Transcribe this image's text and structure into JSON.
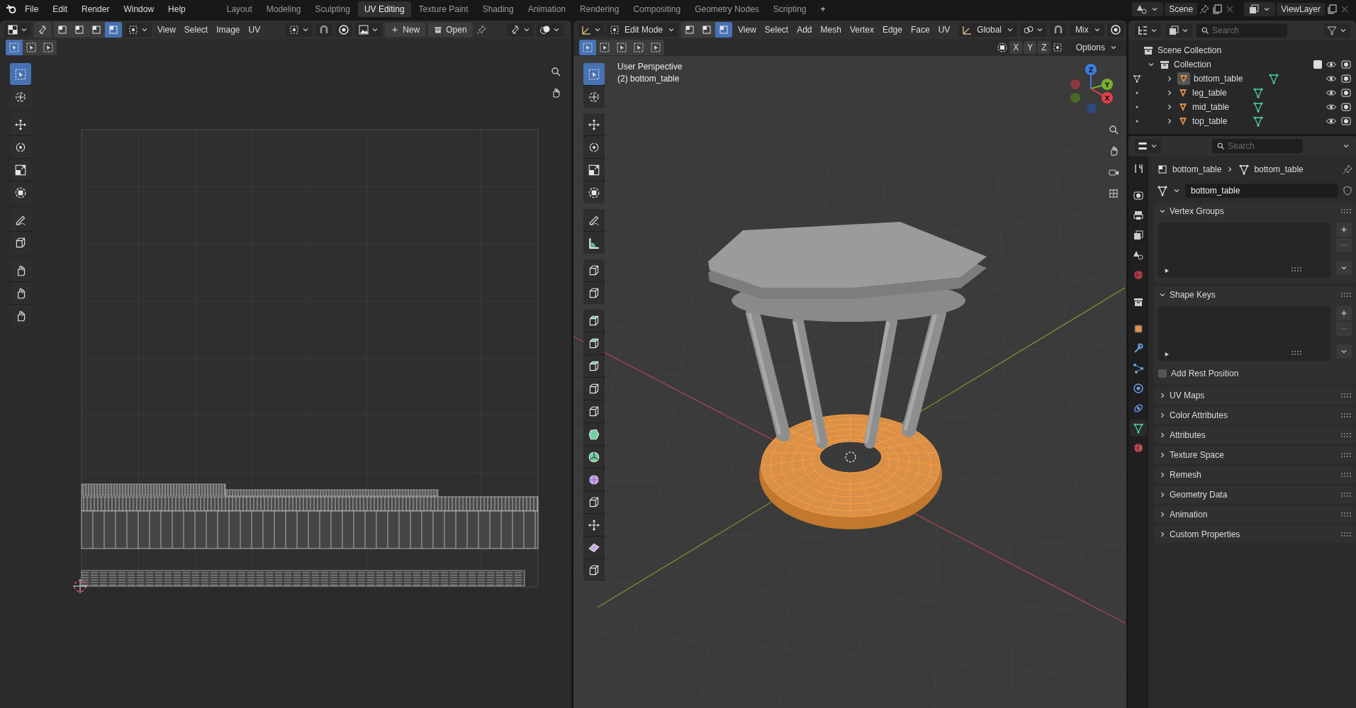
{
  "top_bar": {
    "menus": [
      "File",
      "Edit",
      "Render",
      "Window",
      "Help"
    ],
    "workspaces": [
      {
        "label": "Layout",
        "selected": false
      },
      {
        "label": "Modeling",
        "selected": false
      },
      {
        "label": "Sculpting",
        "selected": false
      },
      {
        "label": "UV Editing",
        "selected": true
      },
      {
        "label": "Texture Paint",
        "selected": false
      },
      {
        "label": "Shading",
        "selected": false
      },
      {
        "label": "Animation",
        "selected": false
      },
      {
        "label": "Rendering",
        "selected": false
      },
      {
        "label": "Compositing",
        "selected": false
      },
      {
        "label": "Geometry Nodes",
        "selected": false
      },
      {
        "label": "Scripting",
        "selected": false
      }
    ],
    "add_workspace": "+",
    "scene": "Scene",
    "view_layer": "ViewLayer"
  },
  "uv_editor": {
    "select_modes": [
      {
        "selected": false
      },
      {
        "selected": false
      },
      {
        "selected": false
      },
      {
        "selected": true
      }
    ],
    "menus": [
      "View",
      "Select",
      "Image",
      "UV"
    ],
    "new_button": "New",
    "open_button": "Open",
    "box_modes": [
      {
        "selected": true
      },
      {
        "selected": false
      },
      {
        "selected": false
      }
    ],
    "tool_groups": [
      [
        {
          "kind": "select",
          "selected": true
        },
        {
          "kind": "cursor",
          "selected": false
        }
      ],
      [
        {
          "kind": "move",
          "selected": false
        },
        {
          "kind": "rotate",
          "selected": false
        },
        {
          "kind": "scale",
          "selected": false
        },
        {
          "kind": "transform",
          "selected": false
        }
      ],
      [
        {
          "kind": "annotate",
          "selected": false
        },
        {
          "kind": "rip",
          "selected": false
        }
      ],
      [
        {
          "kind": "grab",
          "selected": false
        },
        {
          "kind": "pinch",
          "selected": false
        },
        {
          "kind": "relax",
          "selected": false
        }
      ]
    ]
  },
  "viewport": {
    "mode": "Edit Mode",
    "select_modes": [
      {
        "selected": false
      },
      {
        "selected": false
      },
      {
        "selected": true
      }
    ],
    "menus": [
      "View",
      "Select",
      "Add",
      "Mesh",
      "Vertex",
      "Edge",
      "Face",
      "UV"
    ],
    "orientation": "Global",
    "snap_target": "Mix",
    "box_modes": [
      {
        "selected": true
      },
      {
        "selected": false
      },
      {
        "selected": false
      },
      {
        "selected": false
      },
      {
        "selected": false
      }
    ],
    "mirror_axes": [
      "X",
      "Y",
      "Z"
    ],
    "options": "Options",
    "overlay_lines": [
      "User Perspective",
      "(2) bottom_table"
    ],
    "gizmo_axes": [
      "Z",
      "Y",
      "X"
    ],
    "tool_groups": [
      [
        {
          "kind": "select",
          "selected": true
        },
        {
          "kind": "cursor",
          "selected": false
        }
      ],
      [
        {
          "kind": "move",
          "selected": false
        },
        {
          "kind": "rotate",
          "selected": false
        },
        {
          "kind": "scale",
          "selected": false
        },
        {
          "kind": "transform",
          "selected": false
        }
      ],
      [
        {
          "kind": "annotate",
          "selected": false
        },
        {
          "kind": "measure",
          "selected": false
        }
      ],
      [
        {
          "kind": "addcube",
          "selected": false
        },
        {
          "kind": "knife",
          "selected": false
        }
      ],
      [
        {
          "kind": "extrude",
          "selected": false
        },
        {
          "kind": "inset",
          "selected": false
        },
        {
          "kind": "bevel",
          "selected": false
        },
        {
          "kind": "loopcut",
          "selected": false
        },
        {
          "kind": "slide",
          "selected": false
        },
        {
          "kind": "polybuild",
          "selected": false
        },
        {
          "kind": "spin",
          "selected": false
        },
        {
          "kind": "smooth",
          "selected": false
        },
        {
          "kind": "rip",
          "selected": false
        },
        {
          "kind": "shrink",
          "selected": false
        },
        {
          "kind": "shear",
          "selected": false
        },
        {
          "kind": "rip",
          "selected": false
        }
      ]
    ]
  },
  "outliner": {
    "search_placeholder": "Search",
    "scene_collection": "Scene Collection",
    "collection": {
      "name": "Collection",
      "expanded": true,
      "checked": true,
      "children": [
        {
          "name": "bottom_table",
          "selected": true
        },
        {
          "name": "leg_table",
          "selected": false
        },
        {
          "name": "mid_table",
          "selected": false
        },
        {
          "name": "top_table",
          "selected": false
        }
      ]
    }
  },
  "properties": {
    "search_placeholder": "Search",
    "tabs": [
      {
        "kind": "tool",
        "selected": false
      },
      {
        "kind": "render",
        "selected": false
      },
      {
        "kind": "output",
        "selected": false
      },
      {
        "kind": "view_layer",
        "selected": false
      },
      {
        "kind": "scene",
        "selected": false
      },
      {
        "kind": "world",
        "selected": false
      },
      {
        "kind": "collection",
        "selected": false
      },
      {
        "kind": "object",
        "selected": false
      },
      {
        "kind": "modifier",
        "selected": false
      },
      {
        "kind": "particles",
        "selected": false
      },
      {
        "kind": "physics",
        "selected": false
      },
      {
        "kind": "constraints",
        "selected": false
      },
      {
        "kind": "data",
        "selected": true
      },
      {
        "kind": "material",
        "selected": false
      }
    ],
    "breadcrumb": [
      "bottom_table",
      "bottom_table"
    ],
    "mesh_name": "bottom_table",
    "panels": [
      {
        "title": "Vertex Groups",
        "expanded": true
      },
      {
        "title": "Shape Keys",
        "expanded": true,
        "checkbox": {
          "label": "Add Rest Position",
          "checked": false
        }
      },
      {
        "title": "UV Maps",
        "expanded": false
      },
      {
        "title": "Color Attributes",
        "expanded": false
      },
      {
        "title": "Attributes",
        "expanded": false
      },
      {
        "title": "Texture Space",
        "expanded": false
      },
      {
        "title": "Remesh",
        "expanded": false
      },
      {
        "title": "Geometry Data",
        "expanded": false
      },
      {
        "title": "Animation",
        "expanded": false
      },
      {
        "title": "Custom Properties",
        "expanded": false
      }
    ]
  }
}
